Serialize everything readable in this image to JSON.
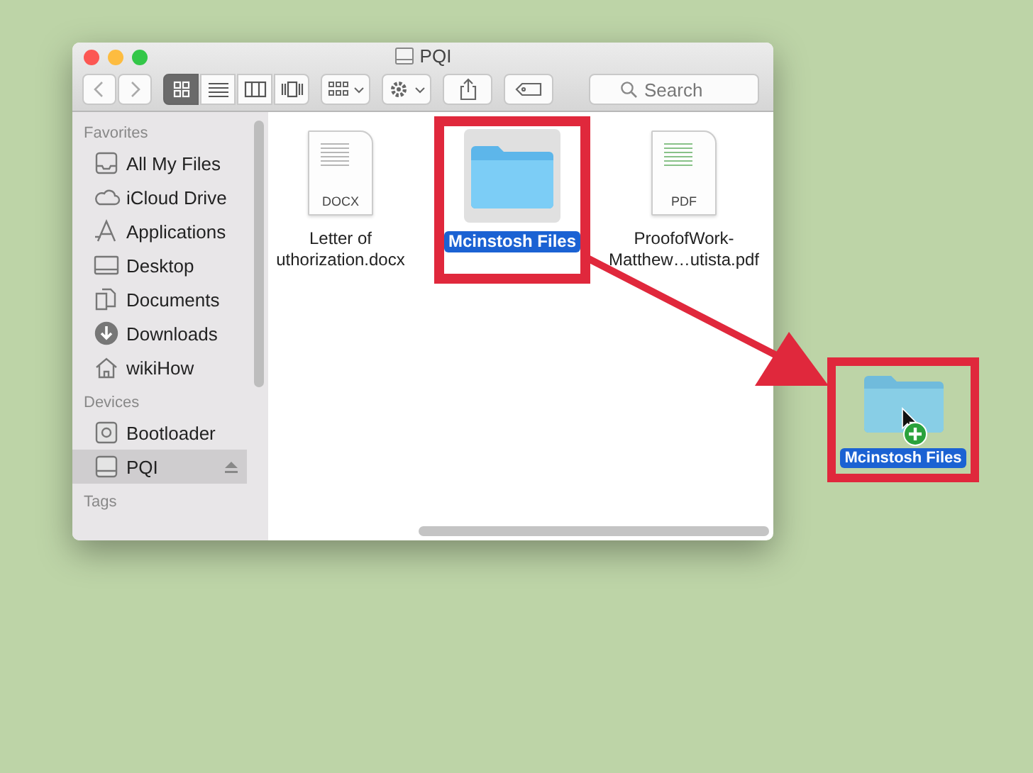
{
  "window": {
    "title": "PQI"
  },
  "toolbar": {
    "views": [
      {
        "kind": "icons",
        "selected": true
      },
      {
        "kind": "list",
        "selected": false
      },
      {
        "kind": "columns",
        "selected": false
      },
      {
        "kind": "coverflow",
        "selected": false
      }
    ],
    "search": {
      "placeholder": "Search"
    }
  },
  "sidebar": {
    "sections": [
      {
        "title": "Favorites",
        "items": [
          {
            "label": "All My Files",
            "kind": "files",
            "selected": false,
            "eject": false
          },
          {
            "label": "iCloud Drive",
            "kind": "cloud",
            "selected": false,
            "eject": false
          },
          {
            "label": "Applications",
            "kind": "apps",
            "selected": false,
            "eject": false
          },
          {
            "label": "Desktop",
            "kind": "desktop",
            "selected": false,
            "eject": false
          },
          {
            "label": "Documents",
            "kind": "documents",
            "selected": false,
            "eject": false
          },
          {
            "label": "Downloads",
            "kind": "downloads",
            "selected": false,
            "eject": false
          },
          {
            "label": "wikiHow",
            "kind": "home",
            "selected": false,
            "eject": false
          }
        ]
      },
      {
        "title": "Devices",
        "items": [
          {
            "label": "Bootloader",
            "kind": "bootdisk",
            "selected": false,
            "eject": false
          },
          {
            "label": "PQI",
            "kind": "disk",
            "selected": true,
            "eject": true
          }
        ]
      },
      {
        "title": "Tags"
      }
    ]
  },
  "files": [
    {
      "kind": "docx",
      "badge": "DOCX",
      "name_lines": [
        "Letter of",
        "uthorization.docx"
      ],
      "selected": false,
      "highlighted": false
    },
    {
      "kind": "folder",
      "name_lines": [
        "Mcinstosh Files"
      ],
      "selected": true,
      "highlighted": true
    },
    {
      "kind": "pdf",
      "badge": "PDF",
      "name_lines": [
        "ProofofWork-",
        "Matthew…utista.pdf"
      ],
      "selected": false,
      "highlighted": false
    }
  ],
  "dragged_item": {
    "label": "Mcinstosh Files",
    "highlighted": true
  }
}
